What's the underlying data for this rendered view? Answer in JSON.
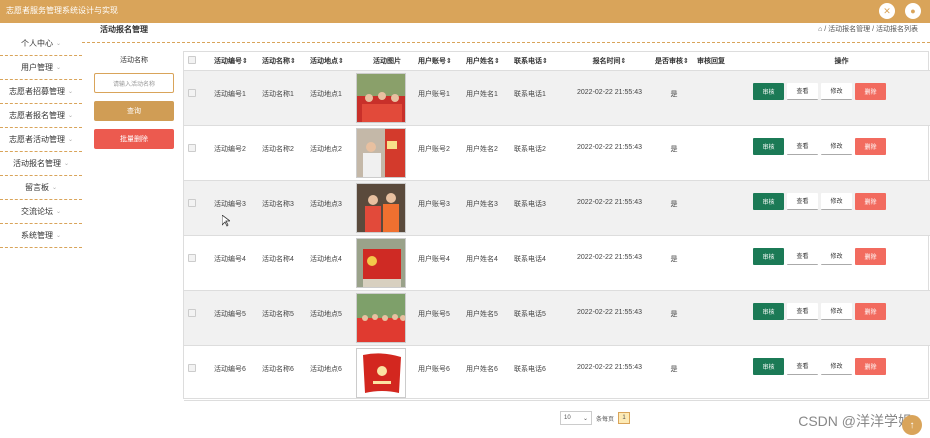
{
  "app": {
    "title": "志愿者服务管理系统设计与实现"
  },
  "colors": {
    "accent": "#d9a45a",
    "review": "#1b7a56",
    "delete": "#f26b5f"
  },
  "sidebar": {
    "items": [
      {
        "label": "个人中心"
      },
      {
        "label": "用户管理"
      },
      {
        "label": "志愿者招募管理"
      },
      {
        "label": "志愿者报名管理"
      },
      {
        "label": "志愿者活动管理"
      },
      {
        "label": "活动报名管理"
      },
      {
        "label": "留言板"
      },
      {
        "label": "交流论坛"
      },
      {
        "label": "系统管理"
      }
    ]
  },
  "page": {
    "title": "活动报名管理",
    "breadcrumb": "⌂ / 活动报名管理 / 活动报名列表"
  },
  "filter": {
    "label": "活动名称",
    "placeholder": "请输入活动名称",
    "search_label": "查询",
    "batch_delete_label": "批量删除"
  },
  "table": {
    "headers": [
      "活动编号⇕",
      "活动名称⇕",
      "活动地点⇕",
      "活动图片",
      "用户账号⇕",
      "用户姓名⇕",
      "联系电话⇕",
      "报名时间⇕",
      "是否审核⇕",
      "审核回复",
      "操作"
    ],
    "rows": [
      {
        "code": "活动编号1",
        "name": "活动名称1",
        "place": "活动地点1",
        "account": "用户账号1",
        "user": "用户姓名1",
        "phone": "联系电话1",
        "time": "2022-02-22 21:55:43",
        "reviewed": "是",
        "reply": ""
      },
      {
        "code": "活动编号2",
        "name": "活动名称2",
        "place": "活动地点2",
        "account": "用户账号2",
        "user": "用户姓名2",
        "phone": "联系电话2",
        "time": "2022-02-22 21:55:43",
        "reviewed": "是",
        "reply": ""
      },
      {
        "code": "活动编号3",
        "name": "活动名称3",
        "place": "活动地点3",
        "account": "用户账号3",
        "user": "用户姓名3",
        "phone": "联系电话3",
        "time": "2022-02-22 21:55:43",
        "reviewed": "是",
        "reply": ""
      },
      {
        "code": "活动编号4",
        "name": "活动名称4",
        "place": "活动地点4",
        "account": "用户账号4",
        "user": "用户姓名4",
        "phone": "联系电话4",
        "time": "2022-02-22 21:55:43",
        "reviewed": "是",
        "reply": ""
      },
      {
        "code": "活动编号5",
        "name": "活动名称5",
        "place": "活动地点5",
        "account": "用户账号5",
        "user": "用户姓名5",
        "phone": "联系电话5",
        "time": "2022-02-22 21:55:43",
        "reviewed": "是",
        "reply": ""
      },
      {
        "code": "活动编号6",
        "name": "活动名称6",
        "place": "活动地点6",
        "account": "用户账号6",
        "user": "用户姓名6",
        "phone": "联系电话6",
        "time": "2022-02-22 21:55:43",
        "reviewed": "是",
        "reply": ""
      }
    ],
    "ops": {
      "review": "审核",
      "view": "查看",
      "edit": "修改",
      "delete": "删除"
    }
  },
  "pagination": {
    "page_size": "10",
    "per_page_label": "条每页",
    "current_page": "1"
  },
  "watermark": "CSDN @洋洋学姐"
}
